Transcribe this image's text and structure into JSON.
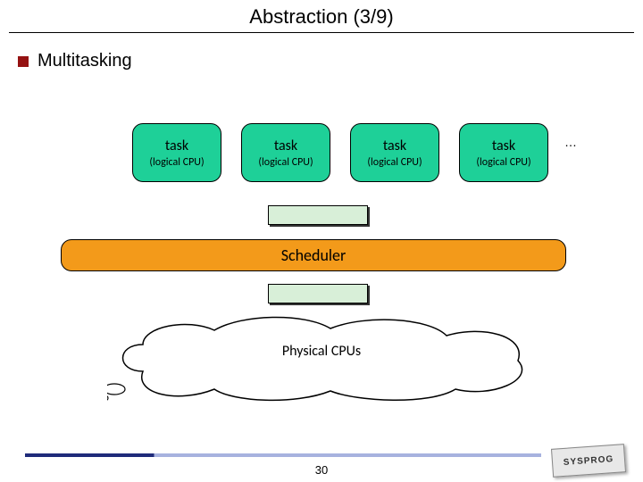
{
  "slide": {
    "title": "Abstraction (3/9)",
    "bullet": "Multitasking",
    "tasks": {
      "label": "task",
      "sublabel": "(logical CPU)",
      "ellipsis": "…"
    },
    "scheduler_label": "Scheduler",
    "phys_label": "Physical CPUs",
    "page_number": "30",
    "logo_text": "SYSPROG"
  }
}
